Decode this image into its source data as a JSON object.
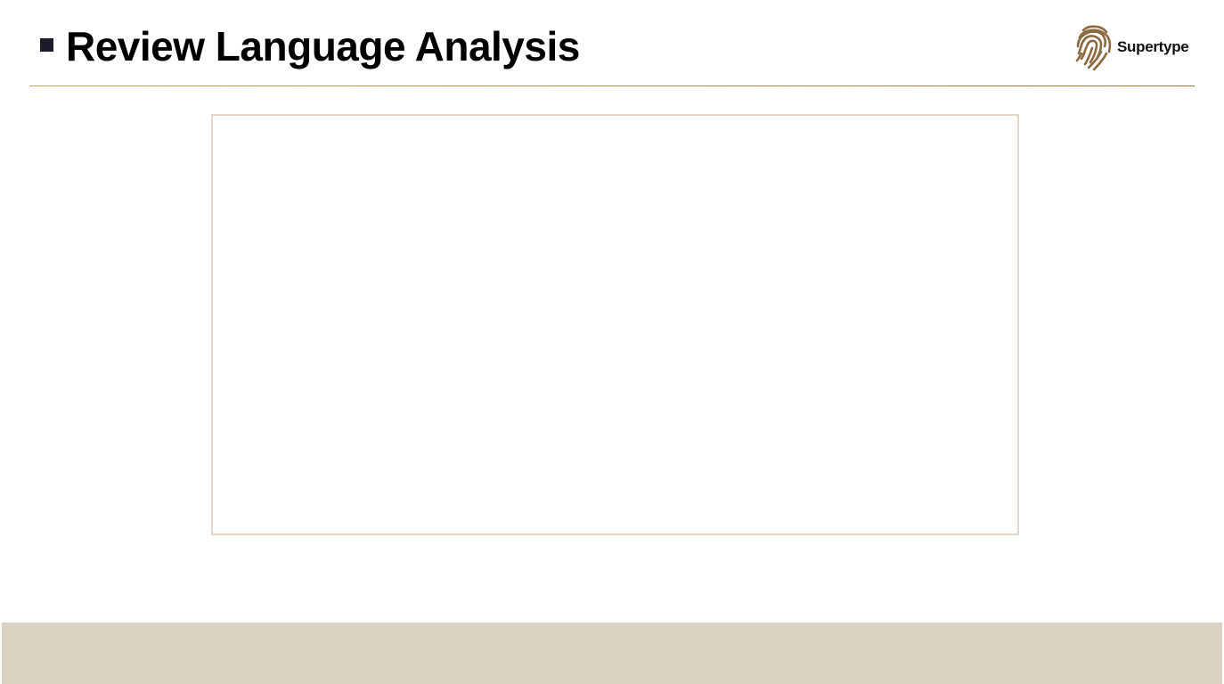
{
  "slide": {
    "title": "Review Language Analysis"
  },
  "brand": {
    "name": "Supertype",
    "logo_icon": "fingerprint-icon",
    "accent_color": "#8c6a3f"
  },
  "colors": {
    "title_bullet": "#1c1b2b",
    "frame_border": "#e3d6c8",
    "footer_band": "#dcd2c3"
  }
}
